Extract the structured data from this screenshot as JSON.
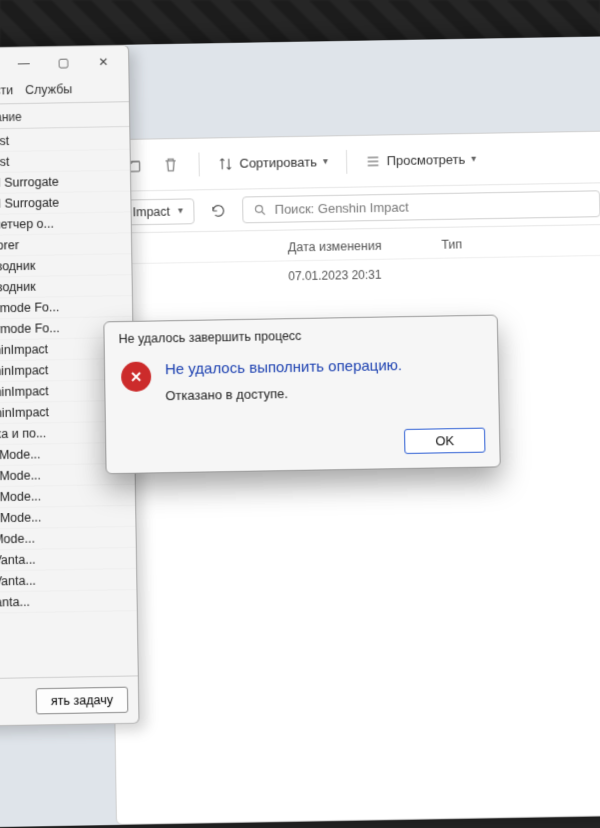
{
  "taskmgr": {
    "window_controls": {
      "min": "—",
      "max": "▢",
      "close": "✕"
    },
    "tabs": {
      "details": "обности",
      "services": "Службы"
    },
    "col_header": "Описание",
    "processes": [
      "Dllhost",
      "Dllhost",
      "COM Surrogate",
      "COM Surrogate",
      "Диспетчер о...",
      "Explorer",
      "Проводник",
      "Проводник",
      "Usermode Fo...",
      "Usermode Fo...",
      "enshinImpact",
      "enshinImpact",
      "enshinImpact",
      "enshinImpact",
      "равка и по...",
      "ovo.Mode...",
      "ovo.Mode...",
      "ovo.Mode...",
      "ovo.Mode...",
      "vo.Mode...",
      "vo.Vanta...",
      "vo.Vanta...",
      "o.Vanta..."
    ],
    "end_task": "ять задачу"
  },
  "explorer": {
    "toolbar": {
      "sort": "Сортировать",
      "view": "Просмотреть"
    },
    "breadcrumb": "Impact",
    "search_placeholder": "Поиск: Genshin Impact",
    "columns": {
      "modified": "Дата изменения",
      "type": "Тип"
    },
    "row_date": "07.01.2023 20:31"
  },
  "dialog": {
    "title": "Не удалось завершить процесс",
    "headline": "Не удалось выполнить операцию.",
    "detail": "Отказано в доступе.",
    "ok": "OK"
  }
}
